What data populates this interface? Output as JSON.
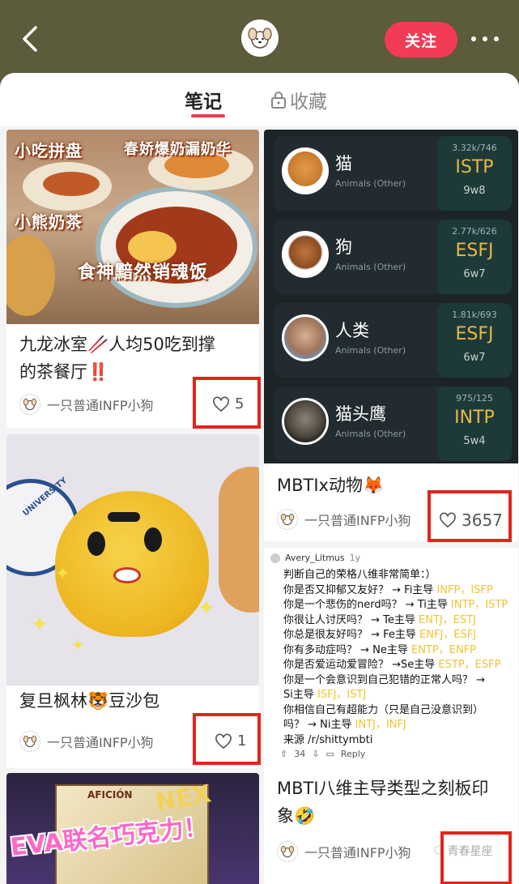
{
  "header": {
    "follow_label": "关注"
  },
  "tabs": [
    {
      "label": "笔记"
    },
    {
      "label": "收藏"
    }
  ],
  "author": "一只普通INFP小狗",
  "watermark": "青春星座",
  "cards": [
    {
      "title_line1": "九龙冰室🥢人均50吃到撑",
      "title_line2": "的茶餐厅‼️",
      "likes": "5",
      "image_text": [
        "小吃拼盘",
        "春娇爆奶漏奶华",
        "小熊奶茶",
        "食神黯然销魂饭"
      ]
    },
    {
      "title_line1": "MBTIx动物🦊",
      "likes": "3657",
      "rows": [
        {
          "name": "猫",
          "sub": "Animals (Other)",
          "stat": "3.32k/746",
          "type": "ISTP",
          "wing": "9w8"
        },
        {
          "name": "狗",
          "sub": "Animals (Other)",
          "stat": "2.77k/626",
          "type": "ESFJ",
          "wing": "6w7"
        },
        {
          "name": "人类",
          "sub": "Animals (Other)",
          "stat": "1.81k/693",
          "type": "ESFJ",
          "wing": "6w7"
        },
        {
          "name": "猫头鹰",
          "sub": "Animals (Other)",
          "stat": "975/125",
          "type": "INTP",
          "wing": "5w4"
        }
      ]
    },
    {
      "title_line1": "复旦枫林🐯豆沙包",
      "likes": "1",
      "image_text": [
        "UNIVERSITY"
      ]
    },
    {
      "title_line1": "MBTI八维主导类型之刻板印",
      "title_line2": "象🤣",
      "reddit": {
        "user": "Avery_Litmus",
        "age": "1y",
        "lines": [
          {
            "text": "判断自己的荣格八维非常简单：）",
            "hl": ""
          },
          {
            "text": "你是否又抑郁又友好？ → Fi主导",
            "hl": "INFP，ISFP"
          },
          {
            "text": "你是一个悲伤的nerd吗？ → Ti主导",
            "hl": "INTP，ISTP"
          },
          {
            "text": "你很让人讨厌吗？ → Te主导",
            "hl": "ENTJ，ESTJ"
          },
          {
            "text": "你总是很友好吗？ → Fe主导",
            "hl": "ENFJ，ESFJ"
          },
          {
            "text": "你有多动症吗？ → Ne主导",
            "hl": "ENTP，ENFP"
          },
          {
            "text": "你是否爱运动爱冒险？ →Se主导",
            "hl": "ESTP，ESFP"
          },
          {
            "text": "你是一个会意识到自己犯错的正常人吗？ →",
            "hl": ""
          },
          {
            "text": "Si主导",
            "hl": "ISFJ，ISTJ"
          },
          {
            "text": "你相信自己有超能力（只是自己没意识到）",
            "hl": ""
          },
          {
            "text": "吗？ → Ni主导",
            "hl": "INTJ，INFJ"
          },
          {
            "text": "来源 /r/shittymbti",
            "hl": ""
          }
        ],
        "votes": "34",
        "reply": "Reply"
      }
    },
    {
      "image_text": [
        "EVA联名巧克力！",
        "AFICIÓN",
        "NEX"
      ]
    }
  ]
}
